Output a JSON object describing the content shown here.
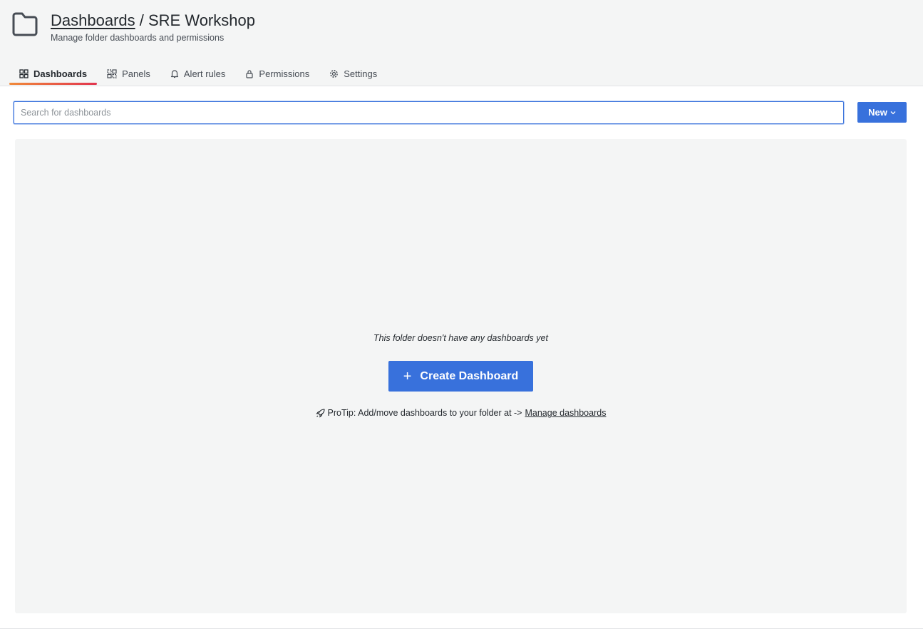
{
  "header": {
    "breadcrumb_link": "Dashboards",
    "breadcrumb_separator": " / ",
    "folder_name": "SRE Workshop",
    "subtitle": "Manage folder dashboards and permissions"
  },
  "tabs": [
    {
      "label": "Dashboards",
      "icon": "apps-icon",
      "active": true
    },
    {
      "label": "Panels",
      "icon": "library-panel-icon",
      "active": false
    },
    {
      "label": "Alert rules",
      "icon": "bell-icon",
      "active": false
    },
    {
      "label": "Permissions",
      "icon": "lock-icon",
      "active": false
    },
    {
      "label": "Settings",
      "icon": "cog-icon",
      "active": false
    }
  ],
  "search": {
    "placeholder": "Search for dashboards",
    "value": ""
  },
  "new_button": {
    "label": "New"
  },
  "empty_state": {
    "message": "This folder doesn't have any dashboards yet",
    "create_button": "Create Dashboard",
    "protip_text": "ProTip: Add/move dashboards to your folder at ->",
    "protip_link": "Manage dashboards"
  },
  "colors": {
    "accent": "#3871dc",
    "tab_indicator_start": "#f08a3a",
    "tab_indicator_end": "#e2354f"
  }
}
